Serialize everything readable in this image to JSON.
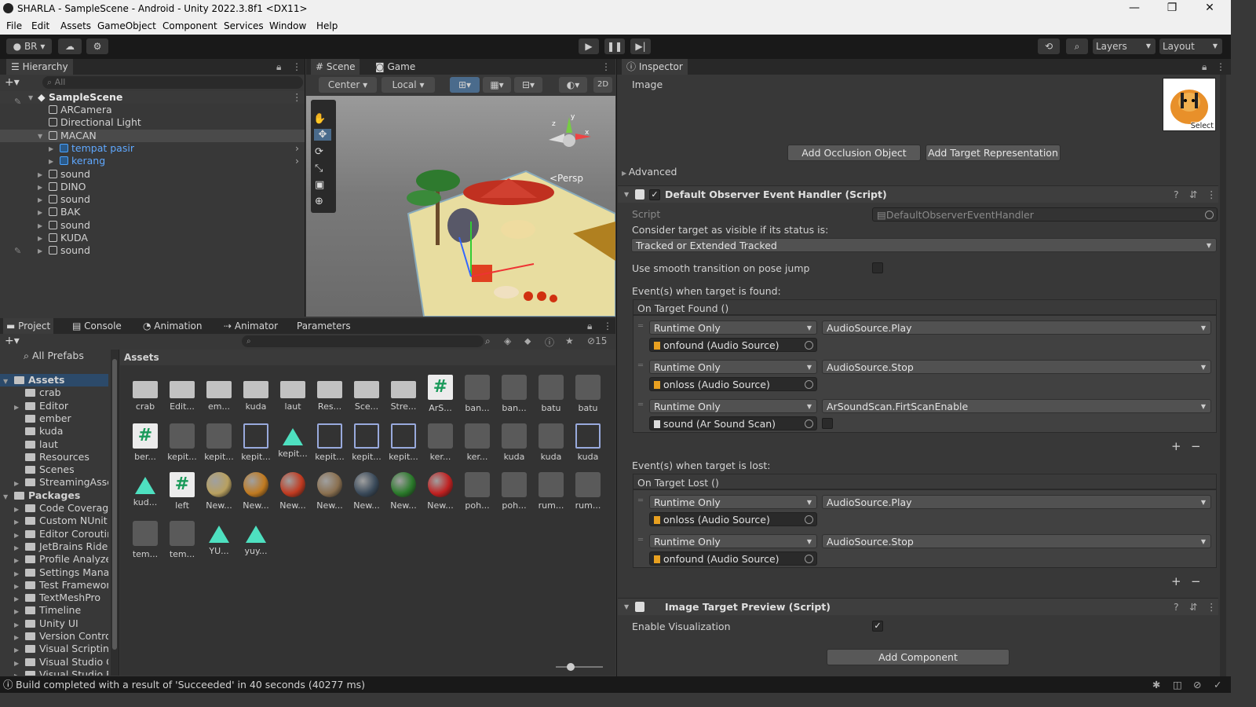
{
  "window": {
    "title": "SHARLA - SampleScene - Android - Unity 2022.3.8f1 <DX11>"
  },
  "menu": [
    "File",
    "Edit",
    "Assets",
    "GameObject",
    "Component",
    "Services",
    "Window",
    "Help"
  ],
  "toolbar": {
    "account": "BR",
    "layers": "Layers",
    "layout": "Layout"
  },
  "hierarchy": {
    "tab": "Hierarchy",
    "search_placeholder": "All",
    "scene": "SampleScene",
    "items": [
      {
        "label": "ARCamera",
        "depth": 1,
        "prefab": false,
        "expandable": false
      },
      {
        "label": "Directional Light",
        "depth": 1,
        "prefab": false,
        "expandable": false
      },
      {
        "label": "MACAN",
        "depth": 1,
        "prefab": false,
        "expandable": true,
        "expanded": true,
        "selected": true
      },
      {
        "label": "tempat pasir",
        "depth": 2,
        "prefab": true,
        "expandable": true
      },
      {
        "label": "kerang",
        "depth": 2,
        "prefab": true,
        "expandable": true
      },
      {
        "label": "sound",
        "depth": 1,
        "prefab": false,
        "expandable": true
      },
      {
        "label": "DINO",
        "depth": 1,
        "prefab": false,
        "expandable": true
      },
      {
        "label": "sound",
        "depth": 1,
        "prefab": false,
        "expandable": true
      },
      {
        "label": "BAK",
        "depth": 1,
        "prefab": false,
        "expandable": true
      },
      {
        "label": "sound",
        "depth": 1,
        "prefab": false,
        "expandable": true
      },
      {
        "label": "KUDA",
        "depth": 1,
        "prefab": false,
        "expandable": true
      },
      {
        "label": "sound",
        "depth": 1,
        "prefab": false,
        "expandable": true
      }
    ]
  },
  "scene_view": {
    "tabs": [
      "Scene",
      "Game"
    ],
    "pivot": "Center",
    "space": "Local",
    "mode2d": "2D",
    "persp": "<Persp",
    "gizmo_axes": {
      "y": "y",
      "x": "x",
      "z": "z"
    }
  },
  "bottom_tabs": [
    "Project",
    "Console",
    "Animation",
    "Animator",
    "Parameters"
  ],
  "project": {
    "hidden_count": "15",
    "favorites": "All Prefabs",
    "breadcrumb": "Assets",
    "tree": [
      {
        "label": "Assets",
        "depth": 0,
        "bold": true,
        "expandable": true,
        "expanded": true
      },
      {
        "label": "crab",
        "depth": 1
      },
      {
        "label": "Editor",
        "depth": 1,
        "expandable": true
      },
      {
        "label": "ember",
        "depth": 1
      },
      {
        "label": "kuda",
        "depth": 1
      },
      {
        "label": "laut",
        "depth": 1
      },
      {
        "label": "Resources",
        "depth": 1
      },
      {
        "label": "Scenes",
        "depth": 1
      },
      {
        "label": "StreamingAsse",
        "depth": 1,
        "expandable": true
      },
      {
        "label": "Packages",
        "depth": 0,
        "bold": true,
        "expandable": true,
        "expanded": true
      },
      {
        "label": "Code Coverage",
        "depth": 1,
        "expandable": true
      },
      {
        "label": "Custom NUnit",
        "depth": 1,
        "expandable": true
      },
      {
        "label": "Editor Coroutin",
        "depth": 1,
        "expandable": true
      },
      {
        "label": "JetBrains Rider",
        "depth": 1,
        "expandable": true
      },
      {
        "label": "Profile Analyze",
        "depth": 1,
        "expandable": true
      },
      {
        "label": "Settings Manag",
        "depth": 1,
        "expandable": true
      },
      {
        "label": "Test Framewor",
        "depth": 1,
        "expandable": true
      },
      {
        "label": "TextMeshPro",
        "depth": 1,
        "expandable": true
      },
      {
        "label": "Timeline",
        "depth": 1,
        "expandable": true
      },
      {
        "label": "Unity UI",
        "depth": 1,
        "expandable": true
      },
      {
        "label": "Version Control",
        "depth": 1,
        "expandable": true
      },
      {
        "label": "Visual Scripting",
        "depth": 1,
        "expandable": true
      },
      {
        "label": "Visual Studio C",
        "depth": 1,
        "expandable": true
      },
      {
        "label": "Visual Studio E",
        "depth": 1,
        "expandable": true
      }
    ],
    "assets": [
      {
        "label": "crab",
        "kind": "folder"
      },
      {
        "label": "Edit...",
        "kind": "folder"
      },
      {
        "label": "em...",
        "kind": "folder"
      },
      {
        "label": "kuda",
        "kind": "folder"
      },
      {
        "label": "laut",
        "kind": "folder"
      },
      {
        "label": "Res...",
        "kind": "folder"
      },
      {
        "label": "Sce...",
        "kind": "folder"
      },
      {
        "label": "Stre...",
        "kind": "folder"
      },
      {
        "label": "ArS...",
        "kind": "script"
      },
      {
        "label": "ban...",
        "kind": "model"
      },
      {
        "label": "ban...",
        "kind": "model"
      },
      {
        "label": "batu",
        "kind": "model"
      },
      {
        "label": "batu",
        "kind": "model"
      },
      {
        "label": "ber...",
        "kind": "script"
      },
      {
        "label": "kepit...",
        "kind": "model"
      },
      {
        "label": "kepit...",
        "kind": "model"
      },
      {
        "label": "kepit...",
        "kind": "prefab"
      },
      {
        "label": "kepit...",
        "kind": "tri"
      },
      {
        "label": "kepit...",
        "kind": "prefab"
      },
      {
        "label": "kepit...",
        "kind": "prefab"
      },
      {
        "label": "kepit...",
        "kind": "prefab"
      },
      {
        "label": "ker...",
        "kind": "model"
      },
      {
        "label": "ker...",
        "kind": "model"
      },
      {
        "label": "kuda",
        "kind": "model"
      },
      {
        "label": "kuda",
        "kind": "model"
      },
      {
        "label": "kuda",
        "kind": "prefab"
      },
      {
        "label": "kud...",
        "kind": "tri"
      },
      {
        "label": "left",
        "kind": "script"
      },
      {
        "label": "New...",
        "kind": "ball",
        "color": "#b8a060"
      },
      {
        "label": "New...",
        "kind": "ball",
        "color": "#c07a20"
      },
      {
        "label": "New...",
        "kind": "ball",
        "color": "#c03a20"
      },
      {
        "label": "New...",
        "kind": "ball",
        "color": "#8a7050"
      },
      {
        "label": "New...",
        "kind": "ball",
        "color": "#3a4a5a"
      },
      {
        "label": "New...",
        "kind": "ball",
        "color": "#2a7a2a"
      },
      {
        "label": "New...",
        "kind": "ball",
        "color": "#c02020"
      },
      {
        "label": "poh...",
        "kind": "model"
      },
      {
        "label": "poh...",
        "kind": "model"
      },
      {
        "label": "rum...",
        "kind": "model"
      },
      {
        "label": "rum...",
        "kind": "model"
      },
      {
        "label": "tem...",
        "kind": "model"
      },
      {
        "label": "tem...",
        "kind": "model"
      },
      {
        "label": "YU...",
        "kind": "tri"
      },
      {
        "label": "yuy...",
        "kind": "tri"
      }
    ]
  },
  "inspector": {
    "tab": "Inspector",
    "title": "Image",
    "thumb_select": "Select",
    "btn_occlusion": "Add Occlusion Object",
    "btn_target_rep": "Add Target Representation",
    "advanced": "Advanced",
    "component1": {
      "title": "Default Observer Event Handler (Script)",
      "script_label": "Script",
      "script_value": "DefaultObserverEventHandler",
      "consider_label": "Consider target as visible if its status is:",
      "status_value": "Tracked or Extended Tracked",
      "smooth_label": "Use smooth transition on pose jump",
      "found_label": "Event(s) when target is found:",
      "found_header": "On Target Found ()",
      "found_events": [
        {
          "mode": "Runtime Only",
          "fn": "AudioSource.Play",
          "obj": "onfound (Audio Source)",
          "icon": "audio"
        },
        {
          "mode": "Runtime Only",
          "fn": "AudioSource.Stop",
          "obj": "onloss (Audio Source)",
          "icon": "audio"
        },
        {
          "mode": "Runtime Only",
          "fn": "ArSoundScan.FirtScanEnable",
          "obj": "sound (Ar Sound Scan)",
          "icon": "script",
          "bool": true
        }
      ],
      "lost_label": "Event(s) when target is lost:",
      "lost_header": "On Target Lost ()",
      "lost_events": [
        {
          "mode": "Runtime Only",
          "fn": "AudioSource.Play",
          "obj": "onloss (Audio Source)",
          "icon": "audio"
        },
        {
          "mode": "Runtime Only",
          "fn": "AudioSource.Stop",
          "obj": "onfound (Audio Source)",
          "icon": "audio"
        }
      ],
      "plus": "+",
      "minus": "−"
    },
    "component2": {
      "title": "Image Target Preview (Script)",
      "enable_label": "Enable Visualization"
    },
    "add_component": "Add Component"
  },
  "status": {
    "message": "Build completed with a result of 'Succeeded' in 40 seconds (40277 ms)"
  }
}
